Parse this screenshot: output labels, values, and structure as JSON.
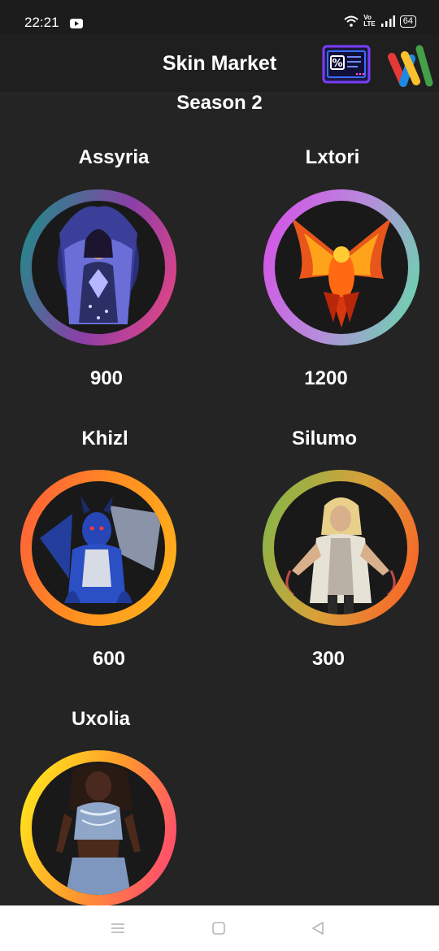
{
  "status": {
    "time": "22:21",
    "volte": "Vo\nLTE",
    "battery": "64"
  },
  "header": {
    "title": "Skin Market",
    "coupon_icon": "coupon-icon",
    "wallet_icon": "wallet-icon"
  },
  "season": {
    "title": "Season 2"
  },
  "skins": [
    {
      "name": "Assyria",
      "price": "900"
    },
    {
      "name": "Lxtori",
      "price": "1200"
    },
    {
      "name": "Khizl",
      "price": "600"
    },
    {
      "name": "Silumo",
      "price": "300"
    },
    {
      "name": "Uxolia",
      "price": ""
    }
  ],
  "nav": {
    "menu_icon": "menu-icon",
    "home_icon": "square-home-icon",
    "back_icon": "back-triangle-icon"
  }
}
